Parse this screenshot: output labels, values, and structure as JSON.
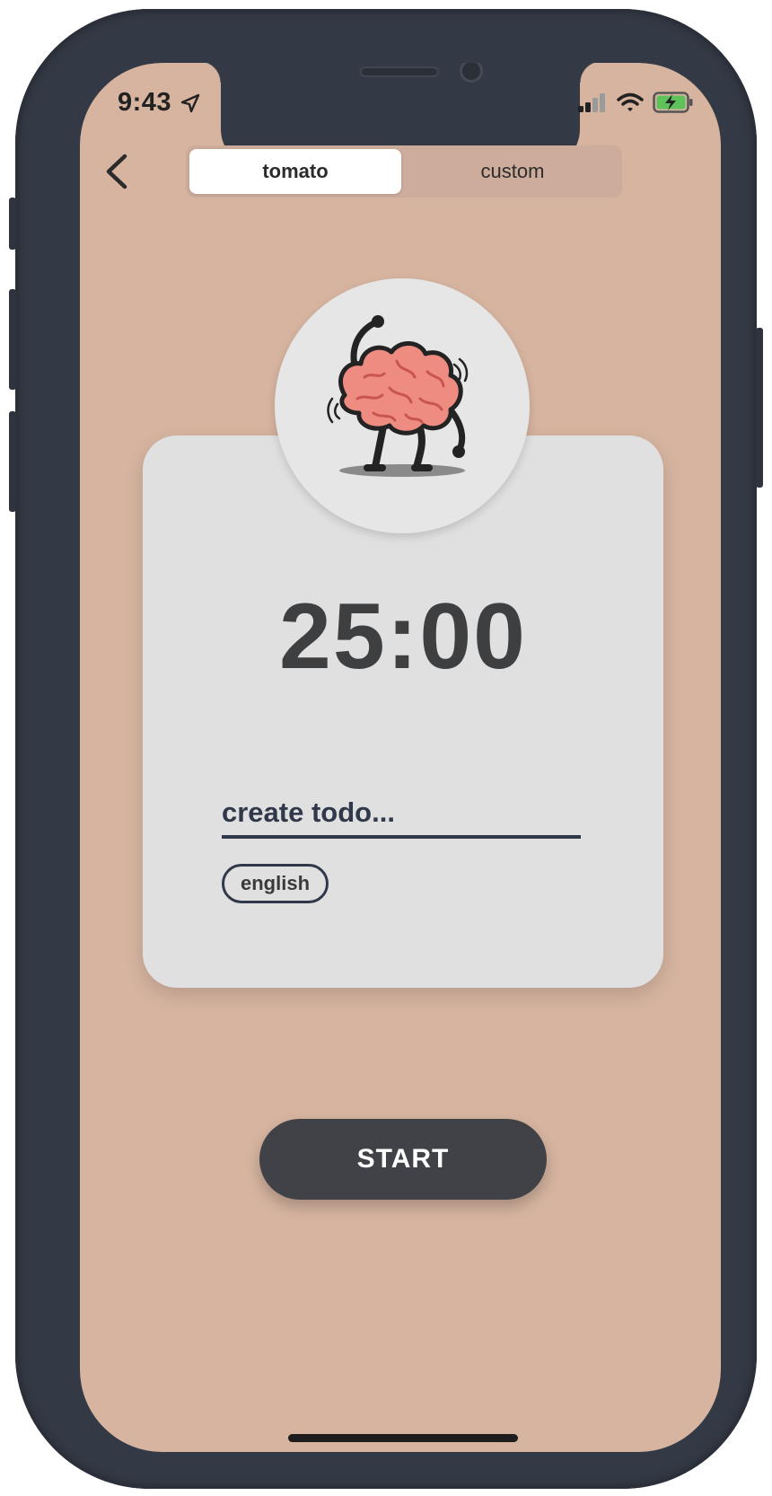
{
  "status_bar": {
    "time": "9:43"
  },
  "header": {
    "tabs": [
      {
        "label": "tomato",
        "active": true
      },
      {
        "label": "custom",
        "active": false
      }
    ]
  },
  "timer": {
    "display": "25:00"
  },
  "todo": {
    "placeholder": "create todo...",
    "value": ""
  },
  "tag": {
    "label": "english"
  },
  "actions": {
    "start_label": "START"
  },
  "colors": {
    "background": "#d6b4a0",
    "card": "#e0e0e0",
    "button": "#404247",
    "text_dark": "#30384a",
    "brain_pink": "#ef8c82"
  },
  "icons": {
    "back": "chevron-left-icon",
    "location": "location-arrow-icon",
    "signal": "cellular-signal-icon",
    "wifi": "wifi-icon",
    "battery": "battery-charging-icon",
    "mascot": "brain-mascot-icon"
  }
}
